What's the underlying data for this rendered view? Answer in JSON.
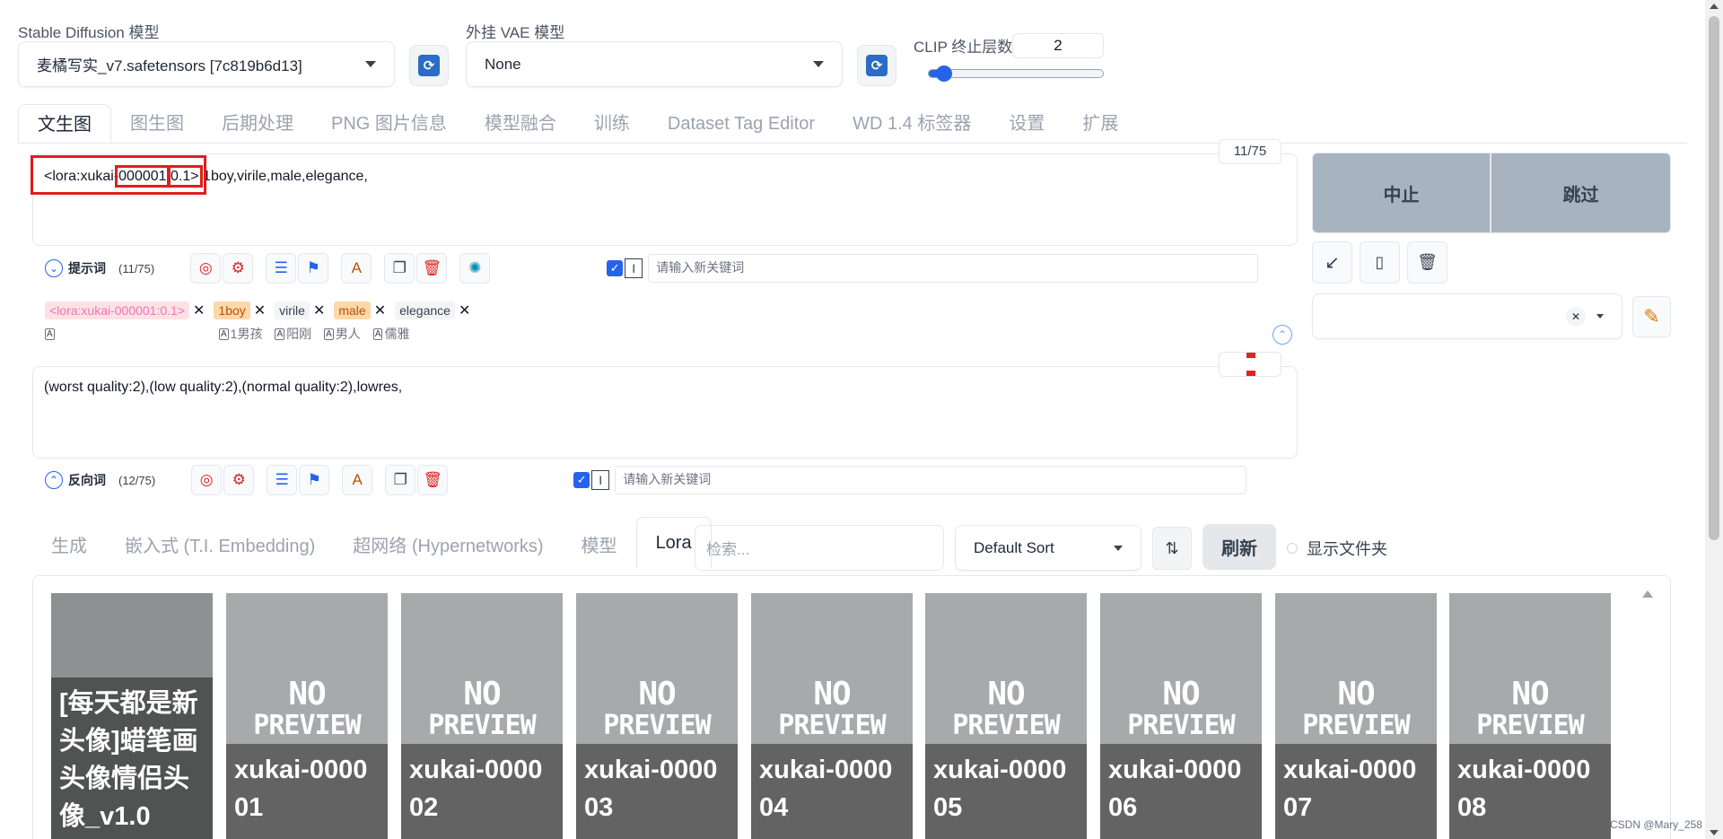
{
  "top": {
    "sd_model_label": "Stable Diffusion 模型",
    "sd_model_value": "麦橘写实_v7.safetensors [7c819b6d13]",
    "vae_label": "外挂 VAE 模型",
    "vae_value": "None",
    "clip_label": "CLIP 终止层数",
    "clip_value": "2",
    "clip_slider_fraction": 0.04
  },
  "tabs": [
    "文生图",
    "图生图",
    "后期处理",
    "PNG 图片信息",
    "模型融合",
    "训练",
    "Dataset Tag Editor",
    "WD 1.4 标签器",
    "设置",
    "扩展"
  ],
  "prompt": {
    "counter": "11/75",
    "text_prefix": "<lora:xukai-",
    "text_box1": "000001",
    "text_colon": ":",
    "text_box2": "0.1>",
    "text_suffix": ",1boy,virile,male,elegance,",
    "section_label": "提示词",
    "section_count": "(11/75)",
    "keyword_placeholder": "请输入新关键词"
  },
  "tags": [
    {
      "text": "<lora:xukai-000001:0.1>",
      "bg": "#fde2e4",
      "color": "#f472b6"
    },
    {
      "text": "1boy",
      "bg": "#fdd8a8",
      "color": "#b45309"
    },
    {
      "text": "virile",
      "bg": "#f3f4f6",
      "color": "#374151"
    },
    {
      "text": "male",
      "bg": "#fdd8a8",
      "color": "#b45309"
    },
    {
      "text": "elegance",
      "bg": "#f3f4f6",
      "color": "#374151"
    }
  ],
  "translations": [
    "1男孩",
    "阳刚",
    "男人",
    "儒雅"
  ],
  "negative": {
    "counter": "",
    "text": "(worst quality:2),(low quality:2),(normal quality:2),lowres,",
    "section_label": "反向词",
    "section_count": "(12/75)",
    "keyword_placeholder": "请输入新关键词"
  },
  "actions": {
    "interrupt": "中止",
    "skip": "跳过"
  },
  "extra_tabs": [
    "生成",
    "嵌入式 (T.I. Embedding)",
    "超网络 (Hypernetworks)",
    "模型",
    "Lora"
  ],
  "extra": {
    "search_placeholder": "检索...",
    "sort_value": "Default Sort",
    "refresh_label": "刷新",
    "show_dirs_label": "显示文件夹"
  },
  "cards": [
    "[每天都是新头像]蜡笔画头像情侣头像_v1.0",
    "xukai-000001",
    "xukai-000002",
    "xukai-000003",
    "xukai-000004",
    "xukai-000005",
    "xukai-000006",
    "xukai-000007",
    "xukai-000008"
  ],
  "no_preview": [
    "NO",
    "PREVIEW"
  ],
  "watermark": "CSDN @Mary_258",
  "colors": {
    "accent": "#2563eb",
    "annotation_red": "#e11d1d"
  }
}
